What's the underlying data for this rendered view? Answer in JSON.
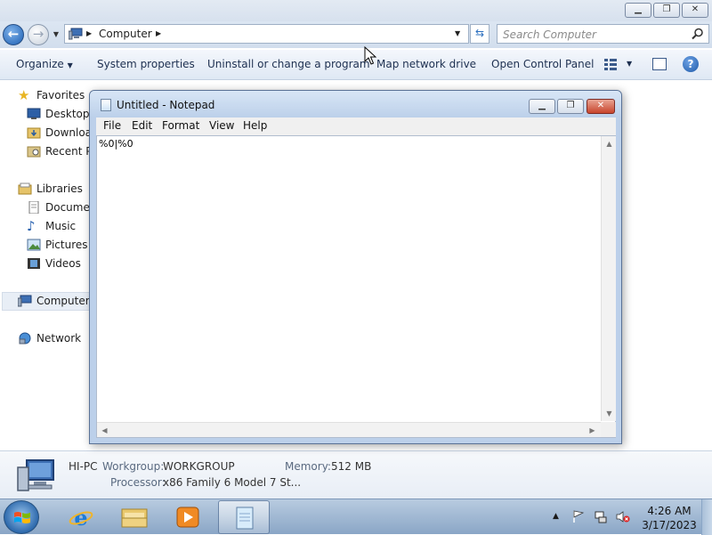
{
  "explorer": {
    "address": {
      "location": "Computer"
    },
    "search": {
      "placeholder": "Search Computer"
    },
    "toolbar": {
      "organize": "Organize",
      "system_properties": "System properties",
      "uninstall": "Uninstall or change a program",
      "map_network": "Map network drive",
      "control_panel": "Open Control Panel"
    },
    "nav": {
      "favorites": "Favorites",
      "desktop": "Desktop",
      "downloads": "Downloads",
      "recent": "Recent Places",
      "libraries": "Libraries",
      "documents": "Documents",
      "music": "Music",
      "pictures": "Pictures",
      "videos": "Videos",
      "computer": "Computer",
      "network": "Network"
    },
    "details": {
      "name": "HI-PC",
      "workgroup_label": "Workgroup:",
      "workgroup": "WORKGROUP",
      "memory_label": "Memory:",
      "memory": "512 MB",
      "processor_label": "Processor:",
      "processor": "x86 Family 6 Model 7 St..."
    }
  },
  "notepad": {
    "title": "Untitled - Notepad",
    "menu": {
      "file": "File",
      "edit": "Edit",
      "format": "Format",
      "view": "View",
      "help": "Help"
    },
    "content": "%0|%0"
  },
  "taskbar": {
    "time": "4:26 AM",
    "date": "3/17/2023",
    "active_app": "notepad"
  },
  "colors": {
    "accent": "#2b6fbf",
    "close_button": "#c8442c",
    "taskbar": "#8aa6c6"
  }
}
